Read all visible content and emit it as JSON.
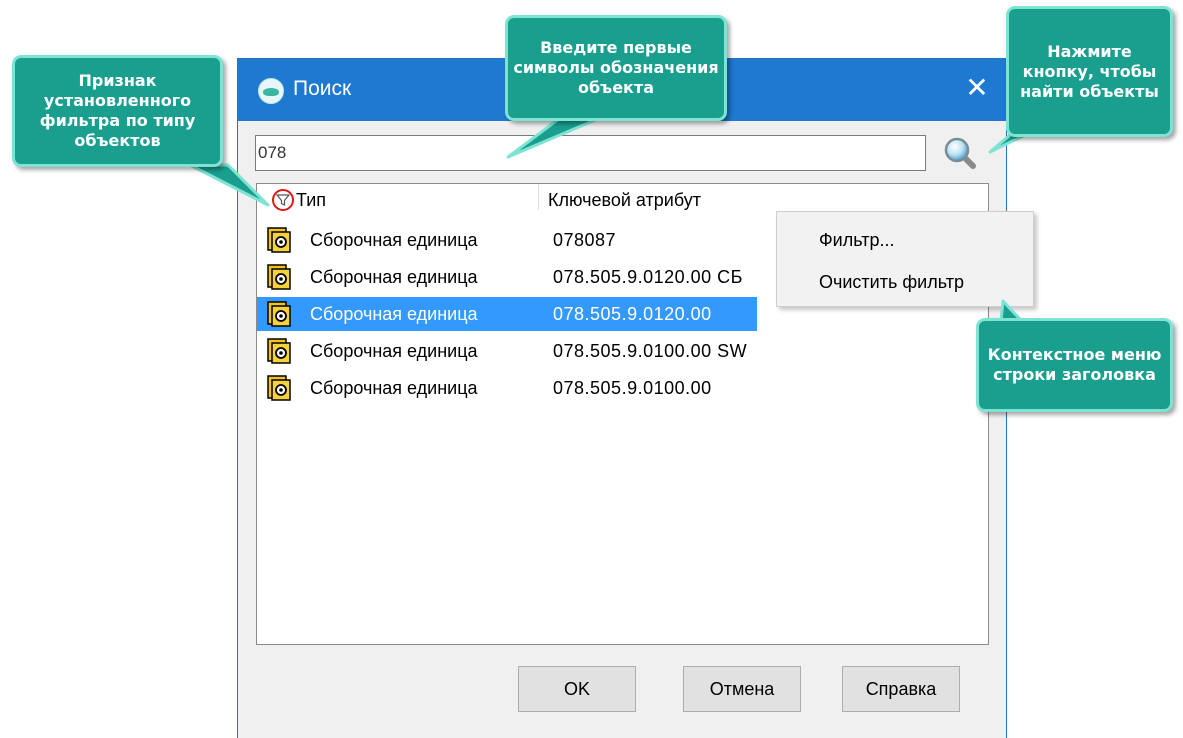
{
  "window": {
    "title": "Поиск",
    "close_symbol": "✕"
  },
  "search": {
    "value": "078",
    "button_icon": "magnifier-icon"
  },
  "list": {
    "columns": [
      "Тип",
      "Ключевой атрибут"
    ],
    "filter_indicator_icon": "filter-funnel-icon",
    "rows": [
      {
        "type": "Сборочная единица",
        "key": "078087",
        "selected": false
      },
      {
        "type": "Сборочная единица",
        "key": "078.505.9.0120.00 СБ",
        "selected": false
      },
      {
        "type": "Сборочная единица",
        "key": "078.505.9.0120.00",
        "selected": true
      },
      {
        "type": "Сборочная единица",
        "key": "078.505.9.0100.00 SW",
        "selected": false
      },
      {
        "type": "Сборочная единица",
        "key": "078.505.9.0100.00",
        "selected": false
      }
    ],
    "row_icon": "assembly-unit-icon"
  },
  "buttons": {
    "ok": "OK",
    "cancel": "Отмена",
    "help": "Справка"
  },
  "context_menu": {
    "items": [
      "Фильтр...",
      "Очистить фильтр"
    ]
  },
  "callouts": {
    "filter_sign": "Признак установленного фильтра по типу объектов",
    "enter_symbols": "Введите первые символы обозначения объекта",
    "press_button": "Нажмите кнопку, чтобы найти объекты",
    "context_menu": "Контекстное меню строки заголовка"
  },
  "colors": {
    "titlebar": "#1e79d0",
    "selection": "#3399ff",
    "callout_fill": "#1a9f8f",
    "callout_border": "#7fe3d4",
    "filter_marker": "#e01818"
  }
}
